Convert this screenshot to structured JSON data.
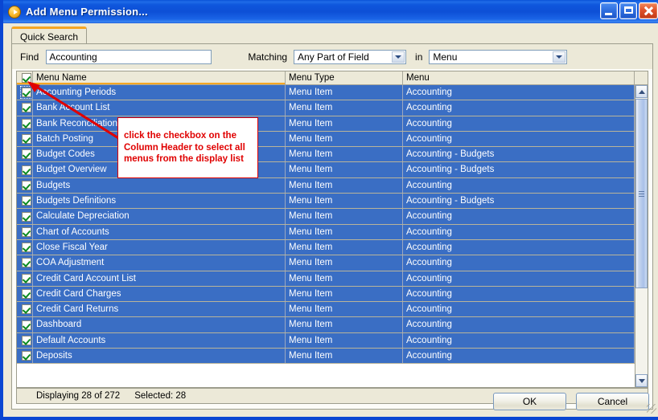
{
  "window": {
    "title": "Add Menu Permission...",
    "icon": "play-circle-icon",
    "minimize_label": "Minimize",
    "maximize_label": "Maximize",
    "close_label": "Close"
  },
  "tab": {
    "label": "Quick Search"
  },
  "search": {
    "find_label": "Find",
    "find_value": "Accounting",
    "matching_label": "Matching",
    "matching_value": "Any Part of Field",
    "in_label": "in",
    "in_value": "Menu"
  },
  "grid": {
    "columns": [
      "",
      "Menu Name",
      "Menu Type",
      "Menu"
    ],
    "header_checkbox_checked": true,
    "rows": [
      {
        "checked": true,
        "name": "Accounting Periods",
        "type": "Menu Item",
        "menu": "Accounting"
      },
      {
        "checked": true,
        "name": "Bank Account List",
        "type": "Menu Item",
        "menu": "Accounting"
      },
      {
        "checked": true,
        "name": "Bank Reconciliation",
        "type": "Menu Item",
        "menu": "Accounting"
      },
      {
        "checked": true,
        "name": "Batch Posting",
        "type": "Menu Item",
        "menu": "Accounting"
      },
      {
        "checked": true,
        "name": "Budget Codes",
        "type": "Menu Item",
        "menu": "Accounting - Budgets"
      },
      {
        "checked": true,
        "name": "Budget Overview",
        "type": "Menu Item",
        "menu": "Accounting - Budgets"
      },
      {
        "checked": true,
        "name": "Budgets",
        "type": "Menu Item",
        "menu": "Accounting"
      },
      {
        "checked": true,
        "name": "Budgets Definitions",
        "type": "Menu Item",
        "menu": "Accounting - Budgets"
      },
      {
        "checked": true,
        "name": "Calculate Depreciation",
        "type": "Menu Item",
        "menu": "Accounting"
      },
      {
        "checked": true,
        "name": "Chart of Accounts",
        "type": "Menu Item",
        "menu": "Accounting"
      },
      {
        "checked": true,
        "name": "Close Fiscal Year",
        "type": "Menu Item",
        "menu": "Accounting"
      },
      {
        "checked": true,
        "name": "COA Adjustment",
        "type": "Menu Item",
        "menu": "Accounting"
      },
      {
        "checked": true,
        "name": "Credit Card Account List",
        "type": "Menu Item",
        "menu": "Accounting"
      },
      {
        "checked": true,
        "name": "Credit Card Charges",
        "type": "Menu Item",
        "menu": "Accounting"
      },
      {
        "checked": true,
        "name": "Credit Card Returns",
        "type": "Menu Item",
        "menu": "Accounting"
      },
      {
        "checked": true,
        "name": "Dashboard",
        "type": "Menu Item",
        "menu": "Accounting"
      },
      {
        "checked": true,
        "name": "Default Accounts",
        "type": "Menu Item",
        "menu": "Accounting"
      },
      {
        "checked": true,
        "name": "Deposits",
        "type": "Menu Item",
        "menu": "Accounting"
      }
    ]
  },
  "status": {
    "displaying": "Displaying 28 of 272",
    "selected": "Selected: 28"
  },
  "footer": {
    "ok_label": "OK",
    "cancel_label": "Cancel"
  },
  "annotation": {
    "line1": "click the checkbox on the",
    "line2": "Column Header to select all",
    "line3": "menus from the display list",
    "color": "#e00000"
  },
  "colors": {
    "title_bar": "#0d4fd6",
    "row_selected": "#3a6ec4",
    "panel_face": "#ece9d8",
    "tab_accent": "#f5a623"
  }
}
